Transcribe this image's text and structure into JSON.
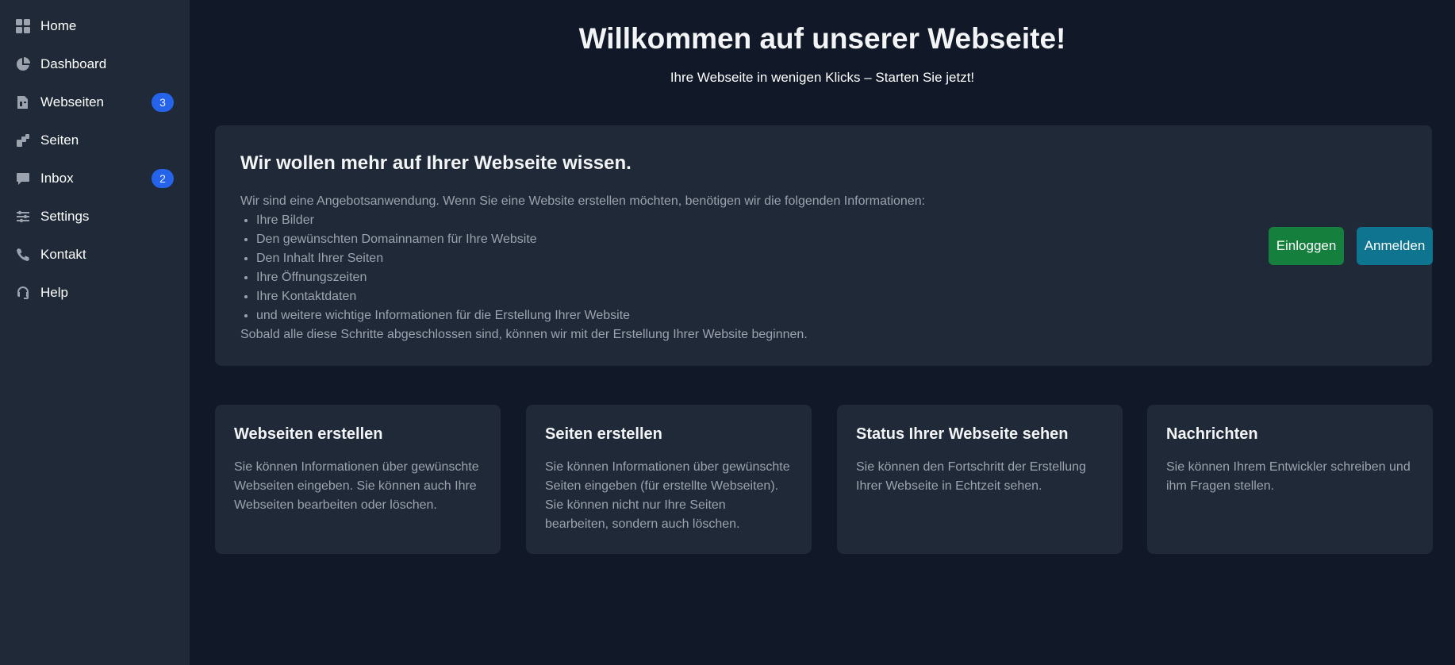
{
  "sidebar": {
    "items": [
      {
        "label": "Home",
        "icon": "grid-icon"
      },
      {
        "label": "Dashboard",
        "icon": "pie-chart-icon"
      },
      {
        "label": "Webseiten",
        "icon": "web-pages-icon",
        "badge": "3"
      },
      {
        "label": "Seiten",
        "icon": "pages-icon"
      },
      {
        "label": "Inbox",
        "icon": "chat-icon",
        "badge": "2"
      },
      {
        "label": "Settings",
        "icon": "sliders-icon"
      },
      {
        "label": "Kontakt",
        "icon": "phone-icon"
      },
      {
        "label": "Help",
        "icon": "headset-icon"
      }
    ]
  },
  "hero": {
    "title": "Willkommen auf unserer Webseite!",
    "subtitle": "Ihre Webseite in wenigen Klicks – Starten Sie jetzt!"
  },
  "info": {
    "title": "Wir wollen mehr auf Ihrer Webseite wissen.",
    "intro": "Wir sind eine Angebotsanwendung. Wenn Sie eine Website erstellen möchten, benötigen wir die folgenden Informationen:",
    "list": [
      "Ihre Bilder",
      "Den gewünschten Domainnamen für Ihre Website",
      "Den Inhalt Ihrer Seiten",
      "Ihre Öffnungszeiten",
      "Ihre Kontaktdaten",
      "und weitere wichtige Informationen für die Erstellung Ihrer Website"
    ],
    "outro": "Sobald alle diese Schritte abgeschlossen sind, können wir mit der Erstellung Ihrer Website beginnen.",
    "login_label": "Einloggen",
    "register_label": "Anmelden"
  },
  "features": [
    {
      "title": "Webseiten erstellen",
      "text": "Sie können Informationen über gewünschte Webseiten eingeben. Sie können auch Ihre Webseiten bearbeiten oder löschen."
    },
    {
      "title": "Seiten erstellen",
      "text": "Sie können Informationen über gewünschte Seiten eingeben (für erstellte Webseiten). Sie können nicht nur Ihre Seiten bearbeiten, sondern auch löschen."
    },
    {
      "title": "Status Ihrer Webseite sehen",
      "text": "Sie können den Fortschritt der Erstellung Ihrer Webseite in Echtzeit sehen."
    },
    {
      "title": "Nachrichten",
      "text": "Sie können Ihrem Entwickler schreiben und ihm Fragen stellen."
    }
  ],
  "colors": {
    "background": "#111827",
    "panel": "#1f2937",
    "badge": "#2563eb",
    "login_button": "#15803d",
    "register_button": "#0e7490"
  }
}
